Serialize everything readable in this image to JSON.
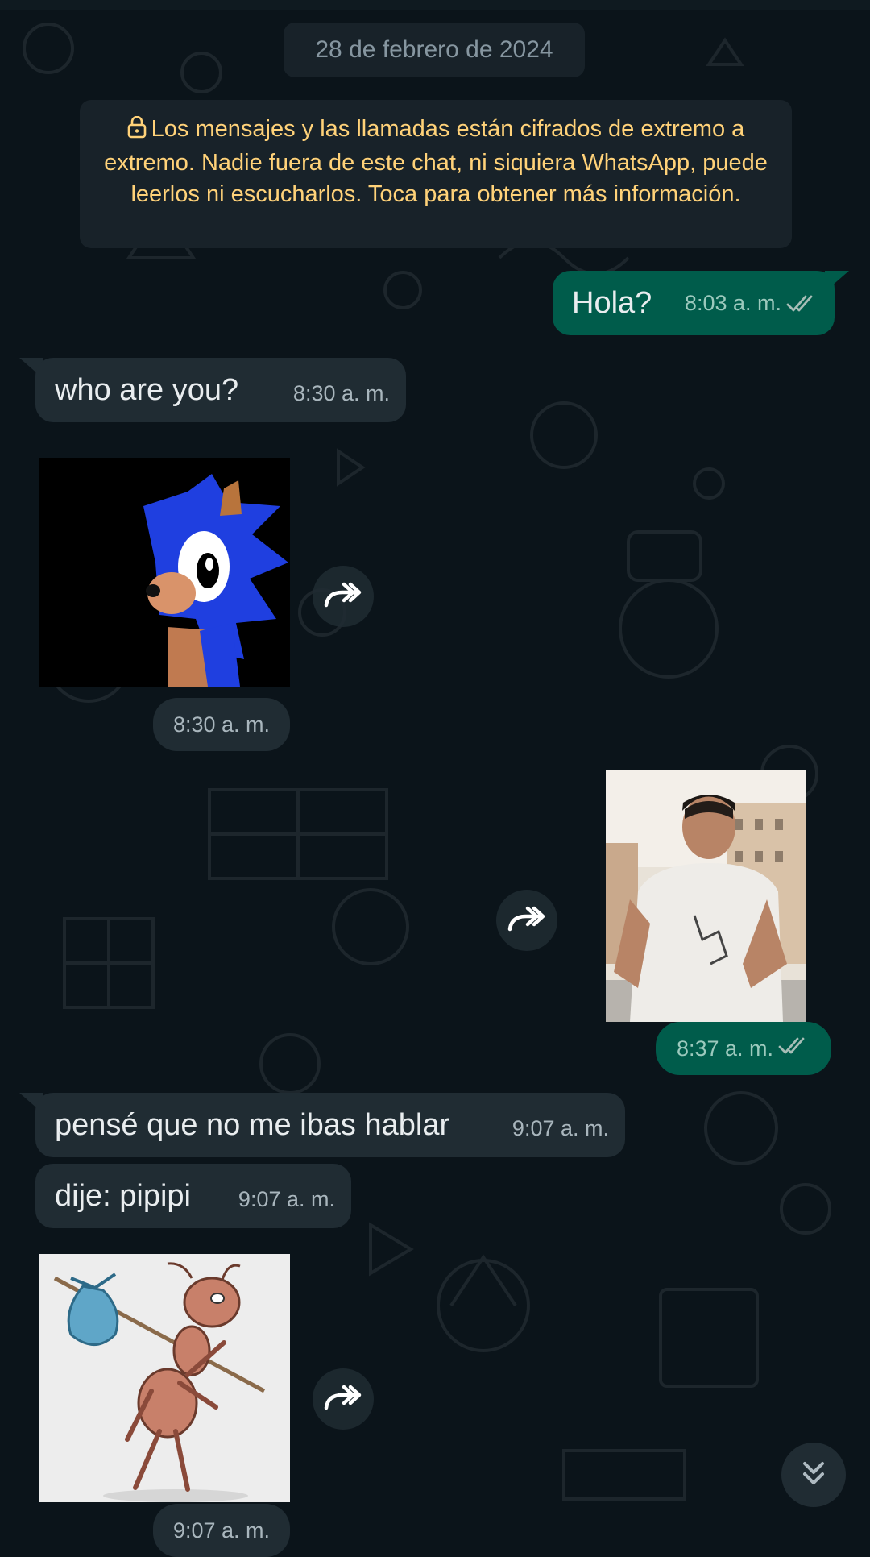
{
  "date_chip": "28 de febrero de 2024",
  "encryption_notice": "Los mensajes y las llamadas están cifrados de extremo a extremo. Nadie fuera de este chat, ni siquiera WhatsApp, puede leerlos ni escucharlos. Toca para obtener más información.",
  "messages": [
    {
      "direction": "out",
      "type": "text",
      "text": "Hola?",
      "time": "8:03 a. m.",
      "status": "read"
    },
    {
      "direction": "in",
      "type": "text",
      "text": "who are you?",
      "time": "8:30 a. m."
    },
    {
      "direction": "in",
      "type": "sticker",
      "icon": "sonic-sticker",
      "time": "8:30 a. m."
    },
    {
      "direction": "out",
      "type": "image",
      "icon": "photo-person",
      "time": "8:37 a. m.",
      "status": "read"
    },
    {
      "direction": "in",
      "type": "text",
      "text": "pensé que no me ibas hablar",
      "time": "9:07 a. m."
    },
    {
      "direction": "in",
      "type": "text",
      "text": "dije: pipipi",
      "time": "9:07 a. m."
    },
    {
      "direction": "in",
      "type": "sticker",
      "icon": "ant-with-bundle-sticker",
      "time": "9:07 a. m."
    }
  ],
  "icons": {
    "forward": "forward-icon",
    "scroll_down": "double-chevron-down-icon",
    "lock": "lock-icon",
    "read_receipt": "double-check-icon"
  },
  "colors": {
    "background": "#0b141a",
    "incoming_bubble": "#202c33",
    "outgoing_bubble": "#005c4b",
    "notice_text": "#ffd279",
    "read_ticks": "#a6bdb6"
  }
}
